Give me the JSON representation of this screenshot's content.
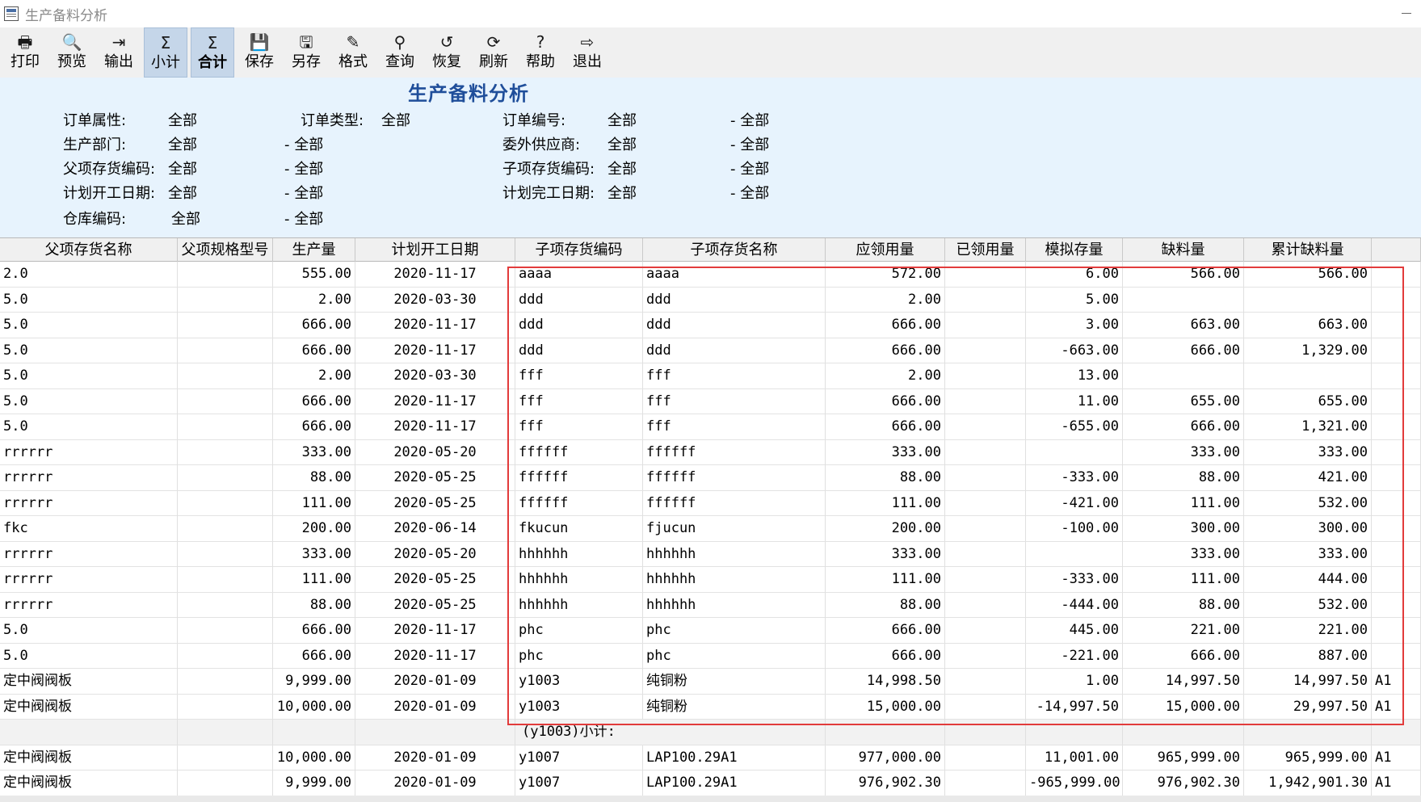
{
  "window": {
    "title": "生产备料分析"
  },
  "toolbar": [
    {
      "name": "print-button",
      "icon": "printer-icon",
      "glyph": "🖶",
      "label": "打印"
    },
    {
      "name": "preview-button",
      "icon": "preview-icon",
      "glyph": "🔍",
      "label": "预览"
    },
    {
      "name": "export-button",
      "icon": "export-icon",
      "glyph": "⇥",
      "label": "输出"
    },
    {
      "name": "subtotal-button",
      "icon": "subtotal-icon",
      "glyph": "Σ",
      "label": "小计",
      "active": true
    },
    {
      "name": "total-button",
      "icon": "sigma-icon",
      "glyph": "Σ",
      "label": "合计",
      "active": true,
      "bold": true
    },
    {
      "name": "save-button",
      "icon": "floppy-icon",
      "glyph": "💾",
      "label": "保存"
    },
    {
      "name": "save-as-button",
      "icon": "save-as-icon",
      "glyph": "🖫",
      "label": "另存"
    },
    {
      "name": "format-button",
      "icon": "format-icon",
      "glyph": "✎",
      "label": "格式"
    },
    {
      "name": "query-button",
      "icon": "binoculars-icon",
      "glyph": "⚲",
      "label": "查询"
    },
    {
      "name": "restore-button",
      "icon": "restore-icon",
      "glyph": "↺",
      "label": "恢复"
    },
    {
      "name": "refresh-button",
      "icon": "refresh-icon",
      "glyph": "⟳",
      "label": "刷新"
    },
    {
      "name": "help-button",
      "icon": "help-icon",
      "glyph": "?",
      "label": "帮助"
    },
    {
      "name": "exit-button",
      "icon": "exit-icon",
      "glyph": "⇨",
      "label": "退出"
    }
  ],
  "report": {
    "title": "生产备料分析"
  },
  "filters": {
    "order_attr": {
      "label": "订单属性:",
      "value": "全部"
    },
    "order_type": {
      "label": "订单类型:",
      "value": "全部"
    },
    "order_no": {
      "label": "订单编号:",
      "from": "全部",
      "to": "- 全部"
    },
    "dept": {
      "label": "生产部门:",
      "from": "全部",
      "to": "- 全部"
    },
    "outsource": {
      "label": "委外供应商:",
      "from": "全部",
      "to": "- 全部"
    },
    "parent_code": {
      "label": "父项存货编码:",
      "from": "全部",
      "to": "- 全部"
    },
    "child_code": {
      "label": "子项存货编码:",
      "from": "全部",
      "to": "- 全部"
    },
    "plan_start": {
      "label": "计划开工日期:",
      "from": "全部",
      "to": "- 全部"
    },
    "plan_end": {
      "label": "计划完工日期:",
      "from": "全部",
      "to": "- 全部"
    },
    "warehouse": {
      "label": "仓库编码:",
      "from": "全部",
      "to": "- 全部"
    }
  },
  "columns": [
    "父项存货名称",
    "父项规格型号",
    "生产量",
    "计划开工日期",
    "子项存货编码",
    "子项存货名称",
    "应领用量",
    "已领用量",
    "模拟存量",
    "缺料量",
    "累计缺料量"
  ],
  "rows": [
    {
      "pname": "2.0",
      "pspec": "",
      "qty": "555.00",
      "date": "2020-11-17",
      "ccode": "aaaa",
      "cname": "aaaa",
      "req": "572.00",
      "used": "",
      "sim": "6.00",
      "short": "566.00",
      "cum": "566.00",
      "extra": ""
    },
    {
      "pname": "5.0",
      "pspec": "",
      "qty": "2.00",
      "date": "2020-03-30",
      "ccode": "ddd",
      "cname": "ddd",
      "req": "2.00",
      "used": "",
      "sim": "5.00",
      "short": "",
      "cum": "",
      "extra": ""
    },
    {
      "pname": "5.0",
      "pspec": "",
      "qty": "666.00",
      "date": "2020-11-17",
      "ccode": "ddd",
      "cname": "ddd",
      "req": "666.00",
      "used": "",
      "sim": "3.00",
      "short": "663.00",
      "cum": "663.00",
      "extra": ""
    },
    {
      "pname": "5.0",
      "pspec": "",
      "qty": "666.00",
      "date": "2020-11-17",
      "ccode": "ddd",
      "cname": "ddd",
      "req": "666.00",
      "used": "",
      "sim": "-663.00",
      "short": "666.00",
      "cum": "1,329.00",
      "extra": ""
    },
    {
      "pname": "5.0",
      "pspec": "",
      "qty": "2.00",
      "date": "2020-03-30",
      "ccode": "fff",
      "cname": "fff",
      "req": "2.00",
      "used": "",
      "sim": "13.00",
      "short": "",
      "cum": "",
      "extra": ""
    },
    {
      "pname": "5.0",
      "pspec": "",
      "qty": "666.00",
      "date": "2020-11-17",
      "ccode": "fff",
      "cname": "fff",
      "req": "666.00",
      "used": "",
      "sim": "11.00",
      "short": "655.00",
      "cum": "655.00",
      "extra": ""
    },
    {
      "pname": "5.0",
      "pspec": "",
      "qty": "666.00",
      "date": "2020-11-17",
      "ccode": "fff",
      "cname": "fff",
      "req": "666.00",
      "used": "",
      "sim": "-655.00",
      "short": "666.00",
      "cum": "1,321.00",
      "extra": ""
    },
    {
      "pname": "rrrrrr",
      "pspec": "",
      "qty": "333.00",
      "date": "2020-05-20",
      "ccode": "ffffff",
      "cname": "ffffff",
      "req": "333.00",
      "used": "",
      "sim": "",
      "short": "333.00",
      "cum": "333.00",
      "extra": ""
    },
    {
      "pname": "rrrrrr",
      "pspec": "",
      "qty": "88.00",
      "date": "2020-05-25",
      "ccode": "ffffff",
      "cname": "ffffff",
      "req": "88.00",
      "used": "",
      "sim": "-333.00",
      "short": "88.00",
      "cum": "421.00",
      "extra": ""
    },
    {
      "pname": "rrrrrr",
      "pspec": "",
      "qty": "111.00",
      "date": "2020-05-25",
      "ccode": "ffffff",
      "cname": "ffffff",
      "req": "111.00",
      "used": "",
      "sim": "-421.00",
      "short": "111.00",
      "cum": "532.00",
      "extra": ""
    },
    {
      "pname": "fkc",
      "pspec": "",
      "qty": "200.00",
      "date": "2020-06-14",
      "ccode": "fkucun",
      "cname": "fjucun",
      "req": "200.00",
      "used": "",
      "sim": "-100.00",
      "short": "300.00",
      "cum": "300.00",
      "extra": ""
    },
    {
      "pname": "rrrrrr",
      "pspec": "",
      "qty": "333.00",
      "date": "2020-05-20",
      "ccode": "hhhhhh",
      "cname": "hhhhhh",
      "req": "333.00",
      "used": "",
      "sim": "",
      "short": "333.00",
      "cum": "333.00",
      "extra": ""
    },
    {
      "pname": "rrrrrr",
      "pspec": "",
      "qty": "111.00",
      "date": "2020-05-25",
      "ccode": "hhhhhh",
      "cname": "hhhhhh",
      "req": "111.00",
      "used": "",
      "sim": "-333.00",
      "short": "111.00",
      "cum": "444.00",
      "extra": ""
    },
    {
      "pname": "rrrrrr",
      "pspec": "",
      "qty": "88.00",
      "date": "2020-05-25",
      "ccode": "hhhhhh",
      "cname": "hhhhhh",
      "req": "88.00",
      "used": "",
      "sim": "-444.00",
      "short": "88.00",
      "cum": "532.00",
      "extra": ""
    },
    {
      "pname": "5.0",
      "pspec": "",
      "qty": "666.00",
      "date": "2020-11-17",
      "ccode": "phc",
      "cname": "phc",
      "req": "666.00",
      "used": "",
      "sim": "445.00",
      "short": "221.00",
      "cum": "221.00",
      "extra": ""
    },
    {
      "pname": "5.0",
      "pspec": "",
      "qty": "666.00",
      "date": "2020-11-17",
      "ccode": "phc",
      "cname": "phc",
      "req": "666.00",
      "used": "",
      "sim": "-221.00",
      "short": "666.00",
      "cum": "887.00",
      "extra": ""
    },
    {
      "pname": "定中阀阀板",
      "pspec": "",
      "qty": "9,999.00",
      "date": "2020-01-09",
      "ccode": "y1003",
      "cname": "纯铜粉",
      "req": "14,998.50",
      "used": "",
      "sim": "1.00",
      "short": "14,997.50",
      "cum": "14,997.50",
      "extra": "A1"
    },
    {
      "pname": "定中阀阀板",
      "pspec": "",
      "qty": "10,000.00",
      "date": "2020-01-09",
      "ccode": "y1003",
      "cname": "纯铜粉",
      "req": "15,000.00",
      "used": "",
      "sim": "-14,997.50",
      "short": "15,000.00",
      "cum": "29,997.50",
      "extra": "A1"
    },
    {
      "subtotal": true,
      "label": "(y1003)小计:"
    },
    {
      "pname": "定中阀阀板",
      "pspec": "",
      "qty": "10,000.00",
      "date": "2020-01-09",
      "ccode": "y1007",
      "cname": "LAP100.29A1",
      "req": "977,000.00",
      "used": "",
      "sim": "11,001.00",
      "short": "965,999.00",
      "cum": "965,999.00",
      "extra": "A1"
    },
    {
      "pname": "定中阀阀板",
      "pspec": "",
      "qty": "9,999.00",
      "date": "2020-01-09",
      "ccode": "y1007",
      "cname": "LAP100.29A1",
      "req": "976,902.30",
      "used": "",
      "sim": "-965,999.00",
      "short": "976,902.30",
      "cum": "1,942,901.30",
      "extra": "A1"
    }
  ]
}
